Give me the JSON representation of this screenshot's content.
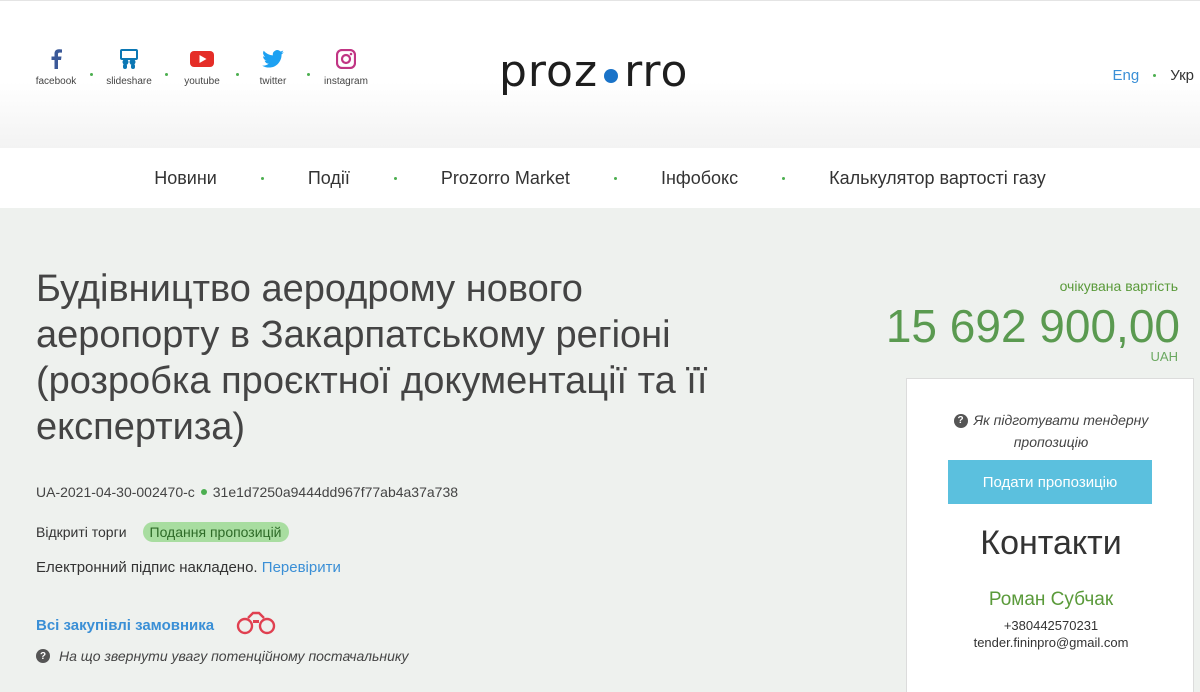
{
  "header": {
    "social": [
      {
        "label": "facebook",
        "icon": "facebook-icon",
        "color": "#3b5998"
      },
      {
        "label": "slideshare",
        "icon": "slideshare-icon",
        "color": "#0b77b4"
      },
      {
        "label": "youtube",
        "icon": "youtube-icon",
        "color": "#e52d27"
      },
      {
        "label": "twitter",
        "icon": "twitter-icon",
        "color": "#1da1f2"
      },
      {
        "label": "instagram",
        "icon": "instagram-icon",
        "color": "#c13584"
      }
    ],
    "logo_left": "proz",
    "logo_right": "rro",
    "lang_eng": "Eng",
    "lang_ukr": "Укр"
  },
  "nav": {
    "items": [
      "Новини",
      "Події",
      "Prozorro Market",
      "Інфобокс",
      "Калькулятор вартості газу"
    ]
  },
  "tender": {
    "title": "Будівництво аеродрому нового аеропорту в Закарпатському регіоні (розробка проєктної документації та її експертиза)",
    "id": "UA-2021-04-30-002470-c",
    "hash": "31e1d7250a9444dd967f77ab4a37a738",
    "procedure": "Відкриті торги",
    "status": "Подання пропозицій",
    "signature_text": "Електронний підпис накладено.",
    "signature_link": "Перевірити",
    "all_purchases": "Всі закупівлі замовника",
    "hint": "На що звернути увагу потенційному постачальнику",
    "estimate_label": "очікувана вартість",
    "estimate_value": "15 692 900,00",
    "currency": "UAH"
  },
  "card": {
    "hint": "Як підготувати тендерну пропозицію",
    "submit_label": "Подати пропозицію",
    "contacts_title": "Контакти",
    "contact_name": "Роман Субчак",
    "contact_phone": "+380442570231",
    "contact_email": "tender.fininpro@gmail.com"
  },
  "colors": {
    "accent_green": "#5a9a3a",
    "link_blue": "#3a8fd6",
    "button_blue": "#5bc0de",
    "status_badge_bg": "#a8dda0",
    "logo_dot": "#1a73c8"
  }
}
